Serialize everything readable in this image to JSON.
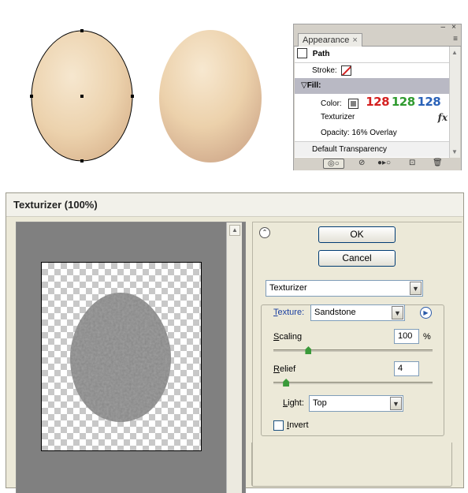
{
  "appearance_panel": {
    "tab_label": "Appearance",
    "tab_close": "×",
    "window_min": "–",
    "window_close": "×",
    "menu_icon": "≡",
    "rows": {
      "path": "Path",
      "stroke_label": "Stroke:",
      "fill_label": "Fill:",
      "color_label": "Color:",
      "color_r": "128",
      "color_g": "128",
      "color_b": "128",
      "texturizer": "Texturizer",
      "fx": "fx",
      "opacity": "Opacity: 16% Overlay",
      "default_transparency": "Default Transparency"
    },
    "colors": {
      "r": "#d42020",
      "g": "#2f9a2f",
      "b": "#2a62b8",
      "selected_row": "#b9b9c4"
    },
    "footer_icons": [
      "new-art-icon",
      "clear-appearance-icon",
      "duplicate-item-icon",
      "new-item-icon",
      "delete-icon"
    ]
  },
  "dialog": {
    "title": "Texturizer (100%)",
    "ok_label": "OK",
    "cancel_label": "Cancel",
    "filter_select": "Texturizer",
    "texture_label_underlined": "T",
    "texture_label_rest": "exture:",
    "texture_value": "Sandstone",
    "scaling_label_underlined": "S",
    "scaling_label_rest": "caling",
    "scaling_value": "100",
    "scaling_unit": "%",
    "scaling_fraction": 0.22,
    "relief_label_underlined": "R",
    "relief_label_rest": "elief",
    "relief_value": "4",
    "relief_fraction": 0.08,
    "light_label_underlined": "L",
    "light_label_rest": "ight:",
    "light_value": "Top",
    "invert_label_underlined": "I",
    "invert_label_rest": "nvert",
    "invert_checked": false
  }
}
